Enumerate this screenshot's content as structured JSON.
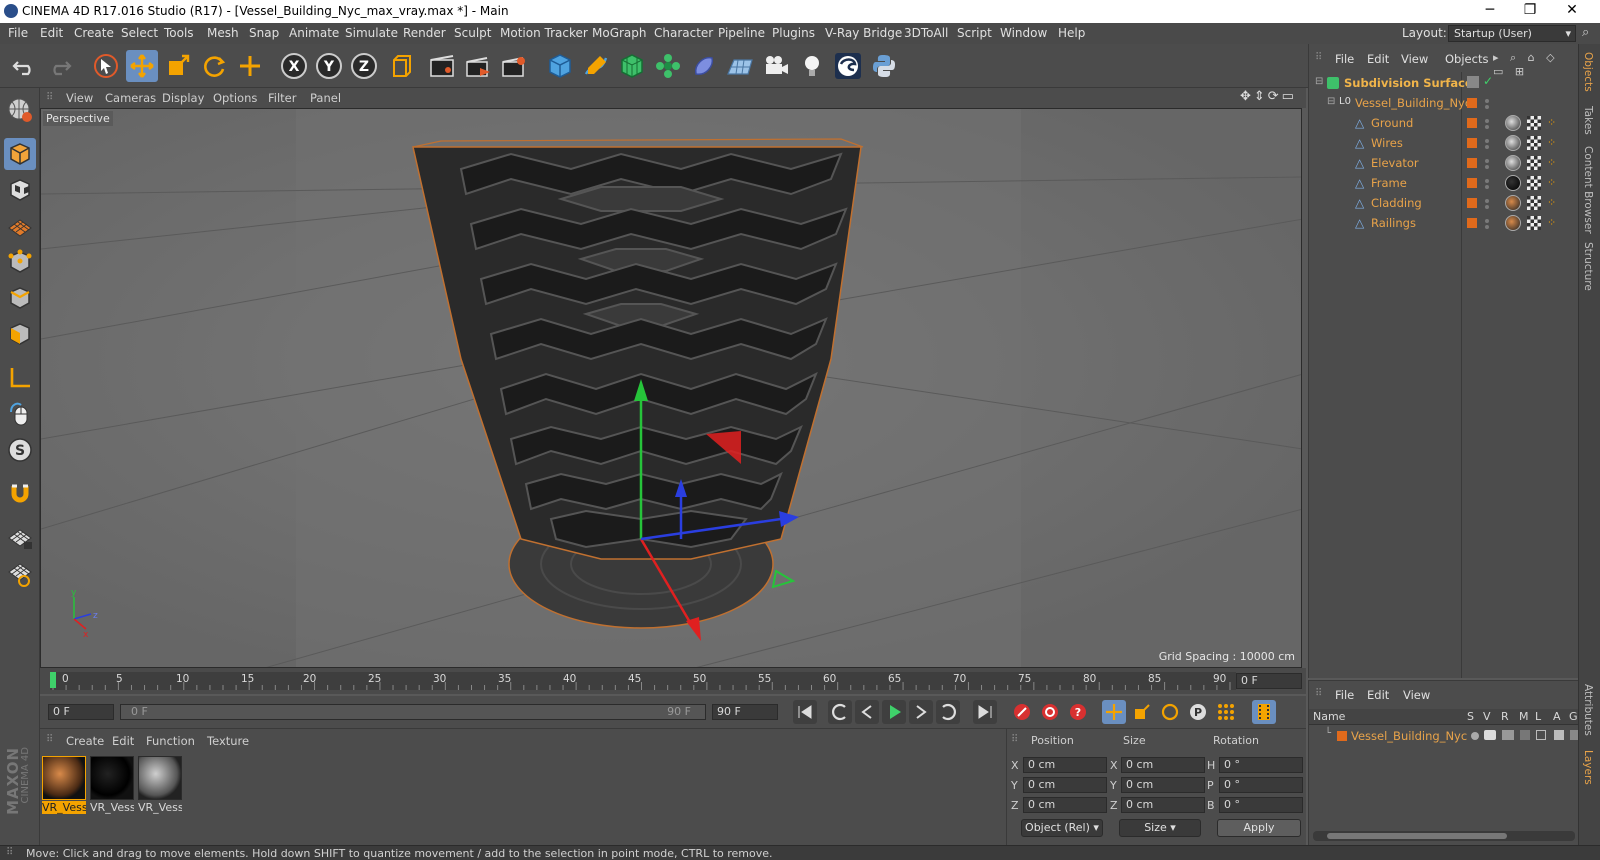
{
  "window": {
    "title": "CINEMA 4D R17.016 Studio (R17) - [Vessel_Building_Nyc_max_vray.max *] - Main",
    "minimize": "─",
    "maximize": "❐",
    "close": "✕"
  },
  "menubar": {
    "items": [
      "File",
      "Edit",
      "Create",
      "Select",
      "Tools",
      "Mesh",
      "Snap",
      "Animate",
      "Simulate",
      "Render",
      "Sculpt",
      "Motion Tracker",
      "MoGraph",
      "Character",
      "Pipeline",
      "Plugins",
      "V-Ray Bridge",
      "3DToAll",
      "Script",
      "Window",
      "Help"
    ],
    "layout_label": "Layout:",
    "layout_value": "Startup (User)"
  },
  "toolbar": {
    "icons": [
      "undo-icon",
      "redo-icon",
      "select-icon",
      "move-icon",
      "scale-icon",
      "rotate-icon",
      "transform-icon",
      "x-axis-icon",
      "y-axis-icon",
      "z-axis-icon",
      "coordinate-system-icon",
      "render-view-icon",
      "render-icon",
      "render-settings-icon",
      "cube-icon",
      "pen-icon",
      "subdivision-icon",
      "mograph-icon",
      "deformer-icon",
      "floor-icon",
      "camera-icon",
      "light-icon",
      "vray-icon",
      "python-icon"
    ],
    "x_label": "X",
    "y_label": "Y",
    "z_label": "Z"
  },
  "viewport": {
    "menu": [
      "View",
      "Cameras",
      "Display",
      "Options",
      "Filter",
      "Panel"
    ],
    "label": "Perspective",
    "grid_spacing": "Grid Spacing : 10000 cm",
    "axis_y": "y",
    "axis_z": "z",
    "axis_x": "x"
  },
  "timeline": {
    "ticks": [
      "0",
      "5",
      "10",
      "15",
      "20",
      "25",
      "30",
      "35",
      "40",
      "45",
      "50",
      "55",
      "60",
      "65",
      "70",
      "75",
      "80",
      "85",
      "90"
    ],
    "current_frame": "0 F"
  },
  "transport": {
    "start_field": "0 F",
    "range_start": "0 F",
    "range_end": "90 F",
    "end_field": "90 F"
  },
  "materials": {
    "menu": [
      "Create",
      "Edit",
      "Function",
      "Texture"
    ],
    "items": [
      {
        "label": "VR_Vess",
        "selected": true
      },
      {
        "label": "VR_Vess",
        "selected": false
      },
      {
        "label": "VR_Vess",
        "selected": false
      }
    ]
  },
  "coordinates": {
    "headers": [
      "Position",
      "Size",
      "Rotation"
    ],
    "rows": [
      {
        "axis": "X",
        "pos": "0 cm",
        "size_axis": "X",
        "size": "0 cm",
        "rot_axis": "H",
        "rot": "0 °"
      },
      {
        "axis": "Y",
        "pos": "0 cm",
        "size_axis": "Y",
        "size": "0 cm",
        "rot_axis": "P",
        "rot": "0 °"
      },
      {
        "axis": "Z",
        "pos": "0 cm",
        "size_axis": "Z",
        "size": "0 cm",
        "rot_axis": "B",
        "rot": "0 °"
      }
    ],
    "mode": "Object (Rel)",
    "size_mode": "Size",
    "apply": "Apply"
  },
  "objects": {
    "menu": [
      "File",
      "Edit",
      "View",
      "Objects"
    ],
    "tree": [
      {
        "name": "Subdivision Surface",
        "level": 0
      },
      {
        "name": "Vessel_Building_Nyc",
        "level": 1
      },
      {
        "name": "Ground",
        "level": 2
      },
      {
        "name": "Wires",
        "level": 2
      },
      {
        "name": "Elevator",
        "level": 2
      },
      {
        "name": "Frame",
        "level": 2
      },
      {
        "name": "Cladding",
        "level": 2
      },
      {
        "name": "Railings",
        "level": 2
      }
    ]
  },
  "layers": {
    "menu": [
      "File",
      "Edit",
      "View"
    ],
    "columns": [
      "Name",
      "S",
      "V",
      "R",
      "M",
      "L",
      "A",
      "G"
    ],
    "rows": [
      {
        "name": "Vessel_Building_Nyc"
      }
    ]
  },
  "side_tabs": [
    "Objects",
    "Takes",
    "Content Browser",
    "Structure"
  ],
  "side_tabs_bottom": [
    "Attributes",
    "Layers"
  ],
  "status": "Move: Click and drag to move elements. Hold down SHIFT to quantize movement / add to the selection in point mode, CTRL to remove.",
  "brand": {
    "line1": "MAXON",
    "line2": "CINEMA 4D"
  },
  "colors": {
    "accent": "#6a8fc0",
    "object_name": "#e8a34a",
    "layer_swatch": "#e06a1c"
  }
}
